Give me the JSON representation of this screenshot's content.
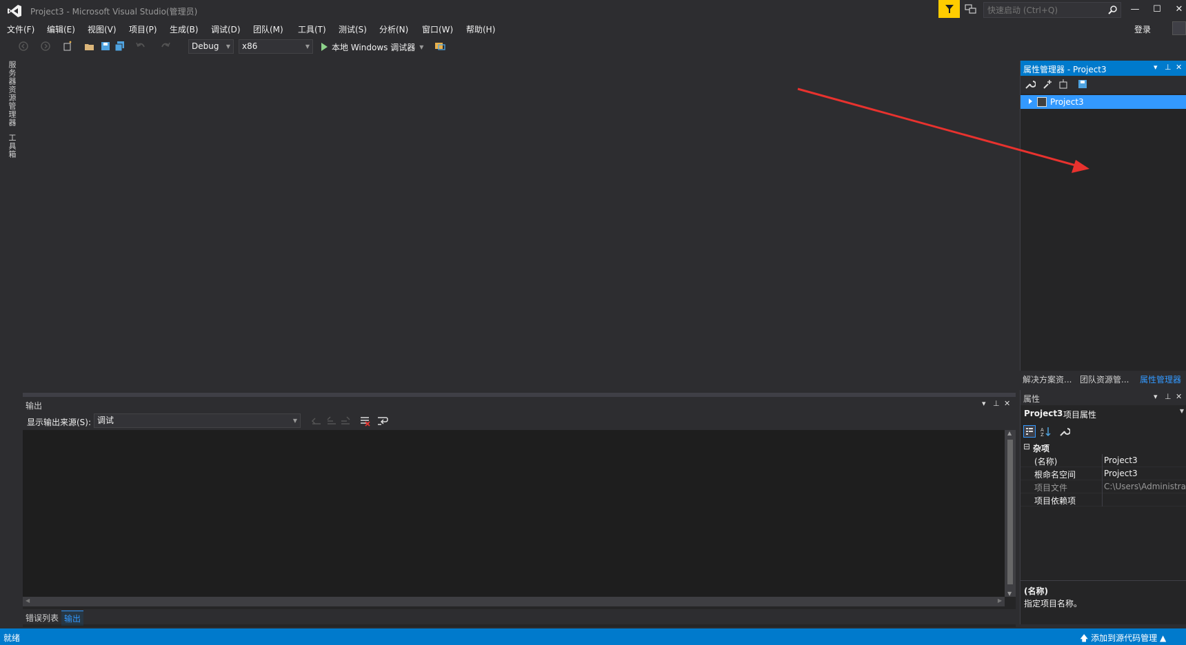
{
  "window": {
    "title": "Project3 - Microsoft Visual Studio(管理员)",
    "quick_launch_placeholder": "快速启动 (Ctrl+Q)",
    "minimize": "—",
    "maximize": "☐",
    "close": "✕"
  },
  "menu": {
    "items": [
      "文件(F)",
      "编辑(E)",
      "视图(V)",
      "项目(P)",
      "生成(B)",
      "调试(D)",
      "团队(M)",
      "工具(T)",
      "测试(S)",
      "分析(N)",
      "窗口(W)",
      "帮助(H)"
    ],
    "sign_in": "登录"
  },
  "toolbar": {
    "config": "Debug",
    "platform": "x86",
    "run_label": "本地 Windows 调试器"
  },
  "left_rail": {
    "tabs": [
      "服务器资源管理器",
      "工具箱"
    ]
  },
  "property_manager": {
    "title": "属性管理器 - Project3",
    "tree_item": "Project3"
  },
  "right_tabs": [
    "解决方案资...",
    "团队资源管...",
    "属性管理器"
  ],
  "properties": {
    "title": "属性",
    "object_name": "Project3",
    "object_type": "项目属性",
    "category": "杂项",
    "rows": [
      {
        "name": "(名称)",
        "value": "Project3"
      },
      {
        "name": "根命名空间",
        "value": "Project3"
      },
      {
        "name": "项目文件",
        "value": "C:\\Users\\Administrato"
      },
      {
        "name": "项目依赖项",
        "value": ""
      }
    ],
    "desc_name": "(名称)",
    "desc_text": "指定项目名称。"
  },
  "output": {
    "title": "输出",
    "source_label": "显示输出来源(S):",
    "source_value": "调试"
  },
  "bottom_tabs": [
    "错误列表",
    "输出"
  ],
  "status": {
    "text": "就绪",
    "source_control": "添加到源代码管理"
  },
  "colors": {
    "accent": "#007acc",
    "selection": "#3399ff",
    "filter": "#ffcc00",
    "annotation_arrow": "#e8322e"
  }
}
